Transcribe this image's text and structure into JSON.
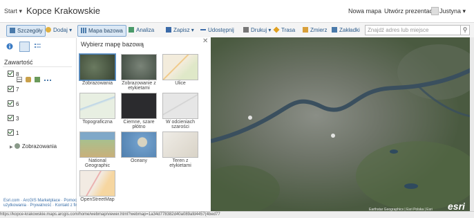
{
  "header": {
    "start_label": "Start",
    "map_title": "Kopce Krakowskie",
    "new_map_label": "Nowa mapa",
    "create_presentation_label": "Utwórz prezentację",
    "user_label": "Justyna"
  },
  "toolbar": {
    "details_label": "Szczegóły",
    "add_label": "Dodaj",
    "basemap_label": "Mapa bazowa",
    "analysis_label": "Analiza",
    "save_label": "Zapisz",
    "share_label": "Udostępnij",
    "print_label": "Drukuj",
    "directions_label": "Trasa",
    "measure_label": "Zmierz",
    "bookmarks_label": "Zakładki",
    "search_placeholder": "Znajdź adres lub miejsce"
  },
  "left_panel": {
    "contents_label": "Zawartość",
    "layers": [
      {
        "label": "8"
      },
      {
        "label": "7"
      },
      {
        "label": "6"
      },
      {
        "label": "3"
      },
      {
        "label": "1"
      }
    ],
    "basemap_layer_label": "Zobrazowania",
    "footer_links": [
      "Esri.com",
      "ArcGIS Marketplace",
      "Pomoc",
      "użytkowania",
      "Prywatność",
      "Kontakt z firmą Esri"
    ]
  },
  "gallery": {
    "title": "Wybierz mapę bazową",
    "items": [
      {
        "label": "Zobrazowania",
        "color": "#4b5a45"
      },
      {
        "label": "Zobrazowanie z etykietami",
        "color": "#505a52"
      },
      {
        "label": "Ulice",
        "color": "#efe8d8"
      },
      {
        "label": "Topograficzna",
        "color": "#e6ecdf"
      },
      {
        "label": "Ciemne, szare płótno",
        "color": "#2b2b2e"
      },
      {
        "label": "W odcieniach szarości",
        "color": "#e1e1e1"
      },
      {
        "label": "National Geographic",
        "color": "#9fb98c"
      },
      {
        "label": "Oceany",
        "color": "#6f9dc9"
      },
      {
        "label": "Teren z etykietami",
        "color": "#ece9e2"
      },
      {
        "label": "OpenStreetMap",
        "color": "#efe6df"
      }
    ]
  },
  "map": {
    "attribution": "Earthstar Geographics | Esri Polska | Esri",
    "logo_text": "esri"
  },
  "status_bar": {
    "url": "https://kopce-krakowskie.maps.arcgis.com/home/webmap/viewer.html?webmap=1a34d778382d40a089afd4457(4bed77"
  }
}
